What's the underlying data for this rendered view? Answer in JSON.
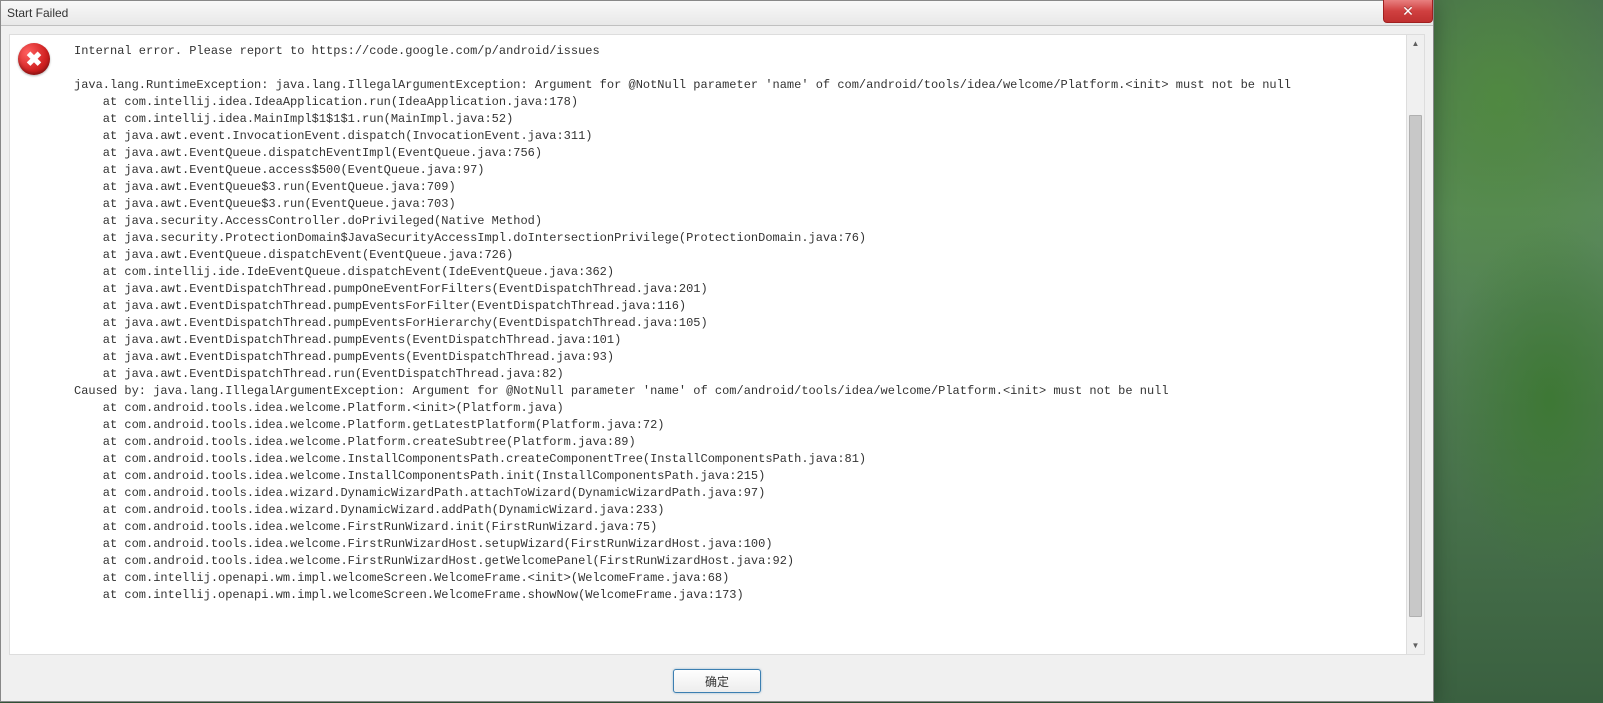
{
  "dialog": {
    "title": "Start Failed",
    "ok_button": "确定",
    "intro": "Internal error. Please report to https://code.google.com/p/android/issues",
    "exception_header": "java.lang.RuntimeException: java.lang.IllegalArgumentException: Argument for @NotNull parameter 'name' of com/android/tools/idea/welcome/Platform.<init> must not be null",
    "stack": [
      "    at com.intellij.idea.IdeaApplication.run(IdeaApplication.java:178)",
      "    at com.intellij.idea.MainImpl$1$1$1.run(MainImpl.java:52)",
      "    at java.awt.event.InvocationEvent.dispatch(InvocationEvent.java:311)",
      "    at java.awt.EventQueue.dispatchEventImpl(EventQueue.java:756)",
      "    at java.awt.EventQueue.access$500(EventQueue.java:97)",
      "    at java.awt.EventQueue$3.run(EventQueue.java:709)",
      "    at java.awt.EventQueue$3.run(EventQueue.java:703)",
      "    at java.security.AccessController.doPrivileged(Native Method)",
      "    at java.security.ProtectionDomain$JavaSecurityAccessImpl.doIntersectionPrivilege(ProtectionDomain.java:76)",
      "    at java.awt.EventQueue.dispatchEvent(EventQueue.java:726)",
      "    at com.intellij.ide.IdeEventQueue.dispatchEvent(IdeEventQueue.java:362)",
      "    at java.awt.EventDispatchThread.pumpOneEventForFilters(EventDispatchThread.java:201)",
      "    at java.awt.EventDispatchThread.pumpEventsForFilter(EventDispatchThread.java:116)",
      "    at java.awt.EventDispatchThread.pumpEventsForHierarchy(EventDispatchThread.java:105)",
      "    at java.awt.EventDispatchThread.pumpEvents(EventDispatchThread.java:101)",
      "    at java.awt.EventDispatchThread.pumpEvents(EventDispatchThread.java:93)",
      "    at java.awt.EventDispatchThread.run(EventDispatchThread.java:82)"
    ],
    "caused_by": "Caused by: java.lang.IllegalArgumentException: Argument for @NotNull parameter 'name' of com/android/tools/idea/welcome/Platform.<init> must not be null",
    "caused_stack": [
      "    at com.android.tools.idea.welcome.Platform.<init>(Platform.java)",
      "    at com.android.tools.idea.welcome.Platform.getLatestPlatform(Platform.java:72)",
      "    at com.android.tools.idea.welcome.Platform.createSubtree(Platform.java:89)",
      "    at com.android.tools.idea.welcome.InstallComponentsPath.createComponentTree(InstallComponentsPath.java:81)",
      "    at com.android.tools.idea.welcome.InstallComponentsPath.init(InstallComponentsPath.java:215)",
      "    at com.android.tools.idea.wizard.DynamicWizardPath.attachToWizard(DynamicWizardPath.java:97)",
      "    at com.android.tools.idea.wizard.DynamicWizard.addPath(DynamicWizard.java:233)",
      "    at com.android.tools.idea.welcome.FirstRunWizard.init(FirstRunWizard.java:75)",
      "    at com.android.tools.idea.welcome.FirstRunWizardHost.setupWizard(FirstRunWizardHost.java:100)",
      "    at com.android.tools.idea.welcome.FirstRunWizardHost.getWelcomePanel(FirstRunWizardHost.java:92)",
      "    at com.intellij.openapi.wm.impl.welcomeScreen.WelcomeFrame.<init>(WelcomeFrame.java:68)",
      "    at com.intellij.openapi.wm.impl.welcomeScreen.WelcomeFrame.showNow(WelcomeFrame.java:173)"
    ]
  }
}
